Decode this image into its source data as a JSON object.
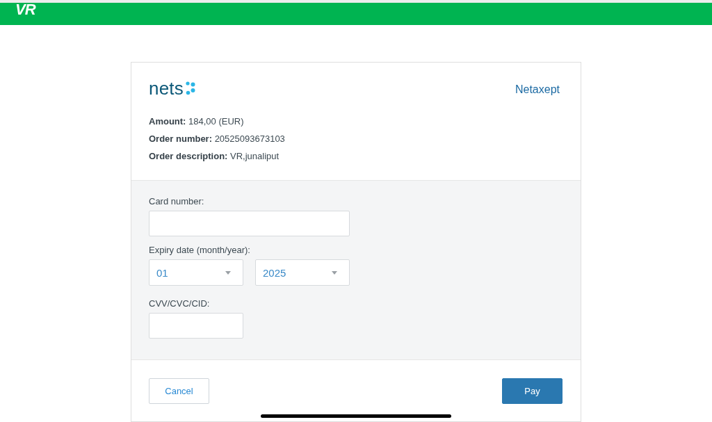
{
  "header": {
    "logo": "VR"
  },
  "payment": {
    "brand": {
      "logo": "nets",
      "product": "Netaxept"
    },
    "order_details": [
      "**Amount:** 184,00 (EUR)",
      "**Order number:** 20525093673103",
      "**Order description:** VR,junaliput"
    ],
    "form": {
      "card_number": {
        "label": "Card number:"
      },
      "expiry": {
        "label": "Expiry date (month/year):",
        "selects": [
          {
            "value": "01"
          },
          {
            "value": "2025"
          }
        ]
      },
      "cvv": {
        "label": "CVV/CVC/CID:"
      }
    },
    "buttons": [
      {
        "label": "Cancel",
        "kind": "secondary"
      },
      {
        "label": "Pay",
        "kind": "primary"
      }
    ]
  }
}
